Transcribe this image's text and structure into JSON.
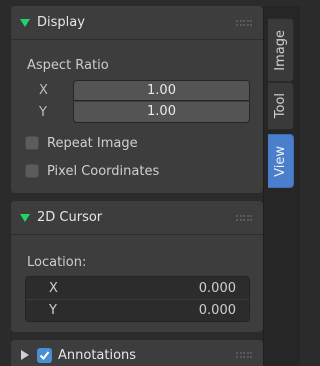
{
  "panels": {
    "display": {
      "title": "Display",
      "aspect_ratio_label": "Aspect Ratio",
      "x_label": "X",
      "x_value": "1.00",
      "y_label": "Y",
      "y_value": "1.00",
      "repeat_image_label": "Repeat Image",
      "repeat_image_checked": false,
      "pixel_coords_label": "Pixel Coordinates",
      "pixel_coords_checked": false
    },
    "cursor_2d": {
      "title": "2D Cursor",
      "location_label": "Location:",
      "x_label": "X",
      "x_value": "0.000",
      "y_label": "Y",
      "y_value": "0.000"
    },
    "annotations": {
      "title": "Annotations",
      "enabled": true
    }
  },
  "tabs": [
    {
      "label": "Image",
      "active": false
    },
    {
      "label": "Tool",
      "active": false
    },
    {
      "label": "View",
      "active": true
    }
  ],
  "colors": {
    "accent": "#4b7fcc",
    "expanded_triangle": "#1fd46a",
    "checkbox_checked": "#4a8fd6"
  }
}
